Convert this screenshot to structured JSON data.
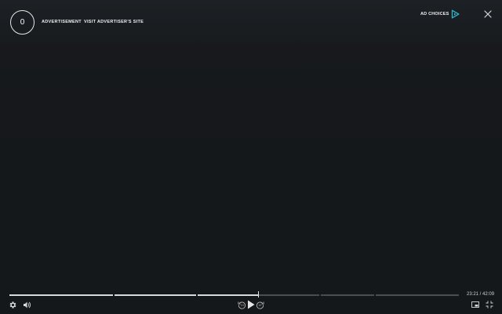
{
  "ad": {
    "countdown": "0",
    "label": "ADVERTISEMENT",
    "visit_link": "VISIT ADVERTISER'S SITE",
    "ad_choices": "AD CHOICES"
  },
  "playback": {
    "current_time": "23:21",
    "duration": "42:09",
    "time_display": "23:21 / 42:09",
    "progress_fraction": 0.554
  },
  "icons": {
    "countdown": "countdown-ring",
    "ad_choices": "ad-choices-triangle-icon",
    "close": "close-icon",
    "settings": "gear-icon",
    "volume": "speaker-icon",
    "rewind": "rewind-10-icon",
    "play": "play-icon",
    "forward": "forward-10-icon",
    "pip": "picture-in-picture-icon",
    "fullscreen": "fullscreen-exit-icon"
  },
  "colors": {
    "background": "#15181b",
    "accent": "#2bb5c8",
    "played": "#d9d9d9",
    "unplayed": "#4a4e53"
  }
}
